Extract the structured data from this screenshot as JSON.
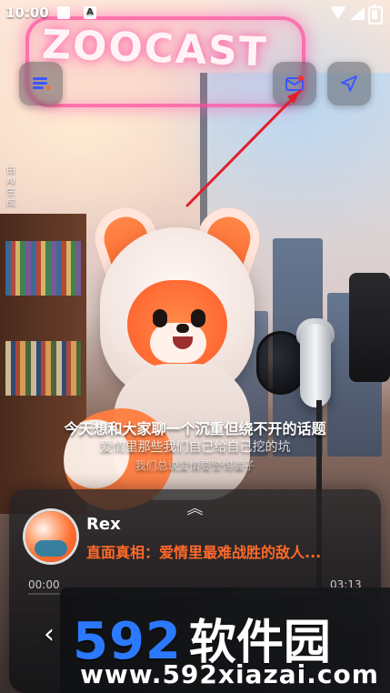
{
  "status_bar": {
    "time": "10:00",
    "notification_badge": "A"
  },
  "background": {
    "neon_sign_text": "ZOOCAST"
  },
  "side_label": {
    "chars": [
      "由",
      "AI",
      "生",
      "成"
    ]
  },
  "center_overlay": {
    "title": "今天想和大家聊一个沉重但绕不开的话题",
    "subtitle_1": "爱情里那些我们自己给自己挖的坑",
    "subtitle_2": "我们总说爱情要警惕骗子"
  },
  "player": {
    "collapse_icon": "chevron-up-icon",
    "author": "Rex",
    "title": "直面真相：爱情里最难战胜的敌人...",
    "elapsed": "00:00",
    "duration": "03:13",
    "progress_fraction": 0.0,
    "accent": "#ff6a2a"
  },
  "watermark": {
    "brand_digits": "592",
    "brand_cn": "软件园",
    "url": "www.592xiazai.com"
  }
}
